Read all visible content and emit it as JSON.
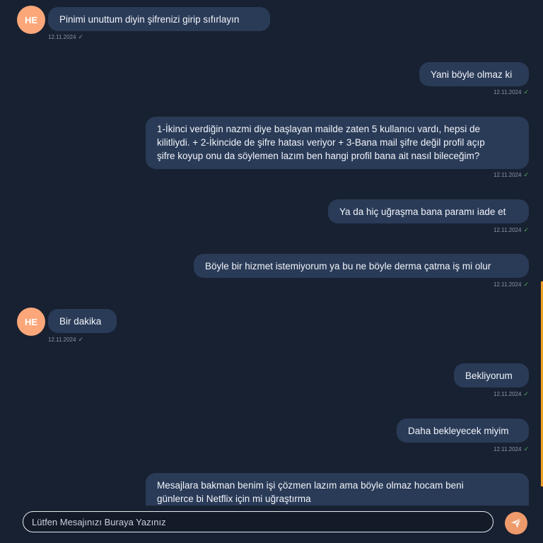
{
  "colors": {
    "background": "#182131",
    "bubble": "#2a3b58",
    "avatar": "#fba77a",
    "scrollbar_accent": "#f0a024",
    "read_check": "#4fb35b"
  },
  "messages": [
    {
      "sender": "HE",
      "avatar": "HE",
      "direction": "incoming",
      "text": "Pinimi unuttum diyin şifrenizi girip sıfırlayın",
      "date": "12.11.2024",
      "status_icon": "single-check-icon"
    },
    {
      "direction": "outgoing",
      "text": "Yani böyle olmaz ki",
      "date": "12.11.2024",
      "status_icon": "read-check-icon"
    },
    {
      "direction": "outgoing",
      "lines": [
        "1-İkinci verdiğin nazmi diye başlayan mailde zaten 5 kullanıcı vardı, hepsi de",
        "kilitliydi. + 2-İkincide de şifre hatası veriyor + 3-Bana mail şifre değil profil açıp",
        "şifre koyup onu da söylemen lazım ben hangi profil bana ait nasıl bileceğim?"
      ],
      "date": "12.11.2024",
      "status_icon": "read-check-icon"
    },
    {
      "direction": "outgoing",
      "text": "Ya da hiç uğraşma bana paramı iade et",
      "date": "12.11.2024",
      "status_icon": "read-check-icon"
    },
    {
      "direction": "outgoing",
      "text": "Böyle bir hizmet istemiyorum ya bu ne böyle derma çatma iş mi olur",
      "date": "12.11.2024",
      "status_icon": "read-check-icon"
    },
    {
      "sender": "HE",
      "avatar": "HE",
      "direction": "incoming",
      "text": "Bir dakika",
      "date": "12.11.2024",
      "status_icon": "single-check-icon"
    },
    {
      "direction": "outgoing",
      "text": "Bekliyorum",
      "date": "12.11.2024",
      "status_icon": "read-check-icon"
    },
    {
      "direction": "outgoing",
      "text": "Daha bekleyecek miyim",
      "date": "12.11.2024",
      "status_icon": "read-check-icon"
    },
    {
      "direction": "outgoing",
      "lines": [
        "Mesajlara bakman benim işi çözmen lazım ama böyle olmaz hocam beni",
        "günlerce bi Netflix için mi uğraştırma"
      ]
    }
  ],
  "composer": {
    "placeholder": "Lütfen Mesajınızı Buraya Yazınız",
    "value": "",
    "send_icon": "paper-plane-icon"
  }
}
